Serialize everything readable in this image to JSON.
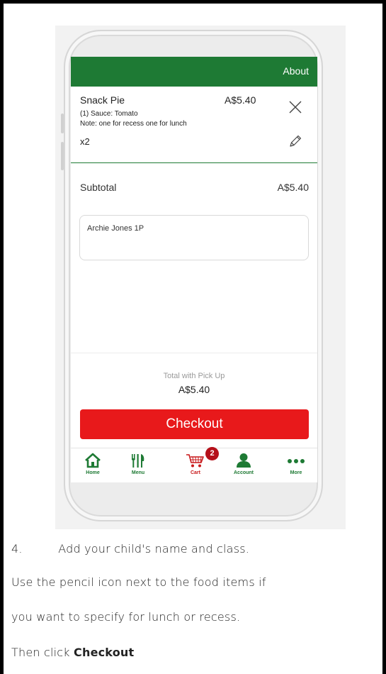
{
  "app": {
    "header": {
      "about_label": "About"
    },
    "cart_item": {
      "name": "Snack Pie",
      "price": "A$5.40",
      "option": "(1) Sauce: Tomato",
      "note": "Note: one for recess one for lunch",
      "quantity": "x2",
      "remove_icon": "close-icon",
      "edit_icon": "pencil-icon"
    },
    "subtotal": {
      "label": "Subtotal",
      "value": "A$5.40"
    },
    "order_note": {
      "value": "Archie Jones 1P"
    },
    "total": {
      "label": "Total with Pick Up",
      "value": "A$5.40"
    },
    "checkout_label": "Checkout",
    "bottom_nav": {
      "items": [
        {
          "label": "Home",
          "icon": "home-icon"
        },
        {
          "label": "Menu",
          "icon": "utensils-icon"
        },
        {
          "label": "Cart",
          "icon": "cart-icon",
          "badge": "2"
        },
        {
          "label": "Account",
          "icon": "person-icon"
        },
        {
          "label": "More",
          "icon": "more-dots-icon"
        }
      ]
    }
  },
  "instructions": {
    "step_number": "4.",
    "step_text": "Add your child's name and class.",
    "line2": "Use the pencil icon next to the food items if",
    "line3": "you want to specify for lunch or recess.",
    "line4_prefix": "Then click ",
    "line4_bold": "Checkout"
  },
  "colors": {
    "brand_green": "#1e7a34",
    "checkout_red": "#e8191b",
    "badge_red": "#b5101a"
  }
}
